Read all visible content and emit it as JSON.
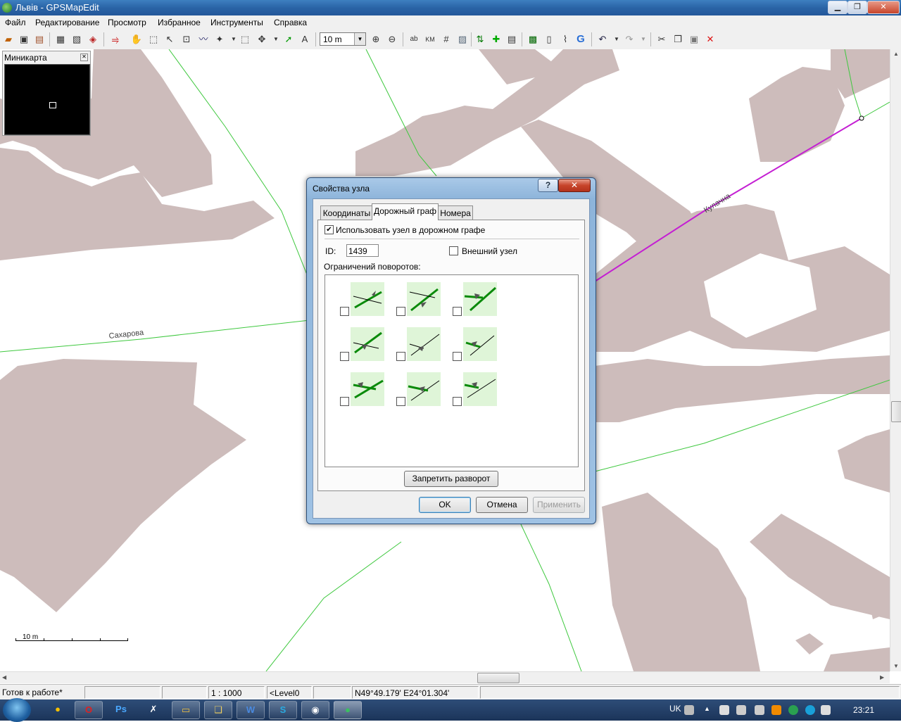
{
  "window": {
    "title": "Львів - GPSMapEdit",
    "controls": [
      "minimize-icon",
      "restore-icon",
      "close-icon"
    ]
  },
  "menu": {
    "items": [
      "Файл",
      "Редактирование",
      "Просмотр",
      "Избранное",
      "Инструменты",
      "Справка"
    ]
  },
  "toolbar": {
    "scale_value": "10 m",
    "icons": [
      "new-map-icon",
      "save-icon",
      "open-icon",
      "properties-icon",
      "import-icon",
      "layers-icon",
      "tracks-icon",
      "hand-icon",
      "zoom-rect-icon",
      "select-icon",
      "edit-node-icon",
      "polyline-icon",
      "magic-wand-icon",
      "select-area-icon",
      "move-icon",
      "connect-icon",
      "label-icon",
      "zoom-in-icon",
      "zoom-out-icon",
      "ab-label-icon",
      "km-icon",
      "grid-icon",
      "hatch-icon",
      "road-graph-icon",
      "add-node-icon",
      "address-icon",
      "image-icon",
      "blank-page-icon",
      "attach-icon",
      "google-icon",
      "undo-icon",
      "redo-icon",
      "cut-icon",
      "copy-icon",
      "paste-icon",
      "delete-icon"
    ]
  },
  "minimap": {
    "title": "Миникарта",
    "close_icon": "close-icon"
  },
  "map": {
    "street_labels": [
      "Сахарова",
      "Кулачна"
    ],
    "colors": {
      "building": "#cdbcbb",
      "road": "#3ec83e",
      "selected_road": "#c41fd3",
      "background": "#ffffff"
    },
    "scale_label": "10 m"
  },
  "dialog": {
    "title": "Свойства узла",
    "help_label": "?",
    "close_label": "✕",
    "tabs": [
      "Координаты",
      "Дорожный граф",
      "Номера"
    ],
    "active_tab": "Дорожный граф",
    "use_in_graph_label": "Использовать узел в дорожном графе",
    "use_in_graph_checked": true,
    "id_label": "ID:",
    "id_value": "1439",
    "external_node_label": "Внешний узел",
    "external_node_checked": false,
    "turn_restrictions_label": "Ограничений поворотов:",
    "turn_restriction_count": 9,
    "forbid_uturn_label": "Запретить разворот",
    "ok_label": "OK",
    "cancel_label": "Отмена",
    "apply_label": "Применить"
  },
  "statusbar": {
    "status": "Готов к работе*",
    "scale": "1 : 1000",
    "level": "<Level0",
    "coords": "N49°49.179' E24°01.304'"
  },
  "taskbar": {
    "language": "UK",
    "clock": "23:21",
    "apps": [
      "avast-icon",
      "opera-icon",
      "photoshop-icon",
      "app-x-icon",
      "explorer-icon",
      "folders-icon",
      "word-icon",
      "skype-icon",
      "media-icon",
      "gpsmapedit-icon"
    ]
  }
}
